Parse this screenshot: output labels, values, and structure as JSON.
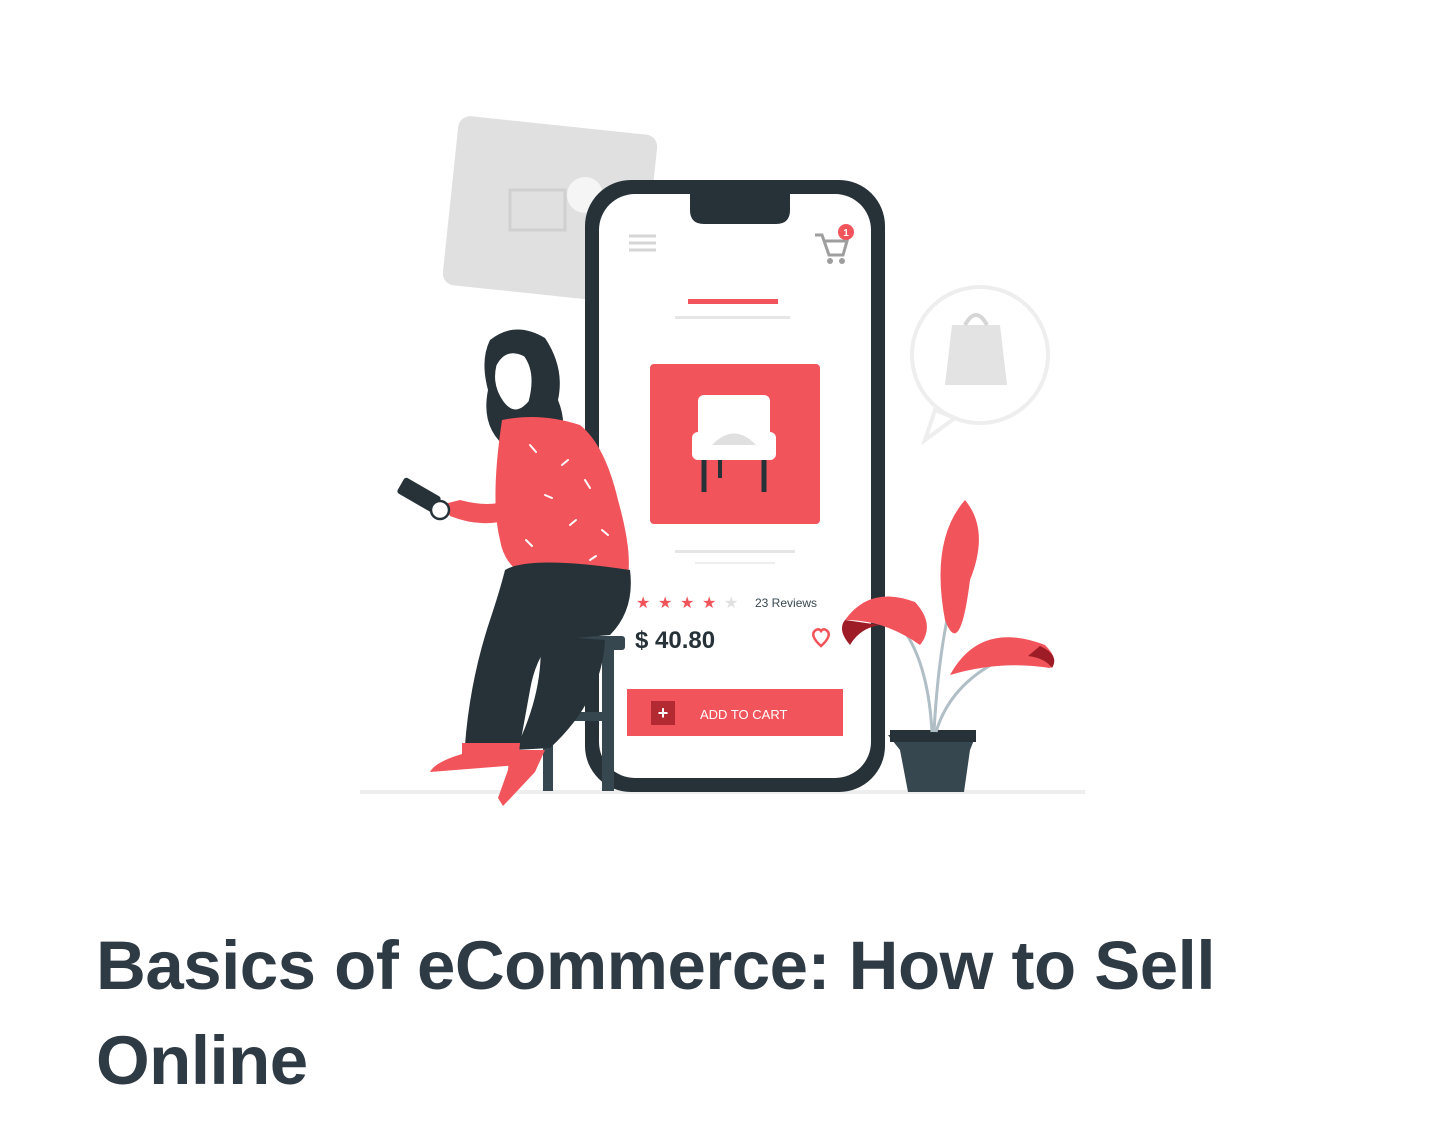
{
  "illustration": {
    "reviews_label": "23 Reviews",
    "price": "$ 40.80",
    "add_to_cart_label": "ADD TO CART",
    "cart_badge_count": "1",
    "rating_stars": 4,
    "rating_max": 5,
    "colors": {
      "accent": "#f2545b",
      "accent_dark": "#9e1c25",
      "phone_frame": "#263238",
      "muted": "#e0e0e0"
    }
  },
  "card": {
    "title": "Basics of eCommerce: How to Sell Online"
  }
}
